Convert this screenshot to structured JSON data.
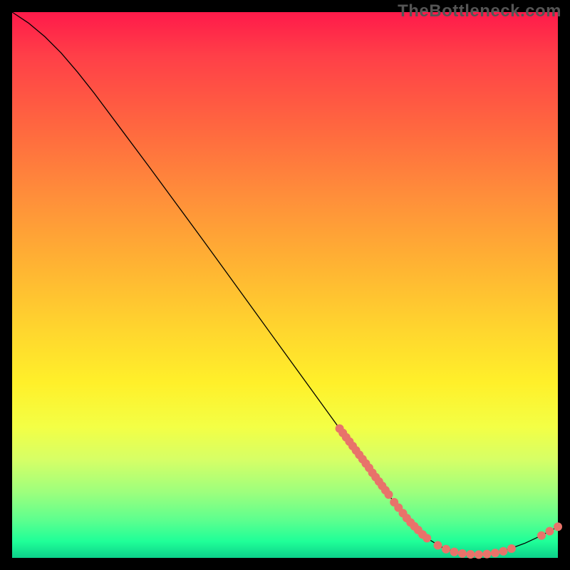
{
  "watermark": "TheBottleneck.com",
  "chart_data": {
    "type": "line",
    "title": "",
    "xlabel": "",
    "ylabel": "",
    "xlim": [
      0,
      100
    ],
    "ylim": [
      0,
      100
    ],
    "grid": false,
    "legend": false,
    "curve": [
      {
        "x": 0,
        "y": 100
      },
      {
        "x": 3,
        "y": 98
      },
      {
        "x": 6,
        "y": 95.5
      },
      {
        "x": 9,
        "y": 92.5
      },
      {
        "x": 12,
        "y": 89
      },
      {
        "x": 15,
        "y": 85.2
      },
      {
        "x": 20,
        "y": 78.5
      },
      {
        "x": 25,
        "y": 71.8
      },
      {
        "x": 30,
        "y": 65
      },
      {
        "x": 35,
        "y": 58.2
      },
      {
        "x": 40,
        "y": 51.3
      },
      {
        "x": 45,
        "y": 44.4
      },
      {
        "x": 50,
        "y": 37.5
      },
      {
        "x": 55,
        "y": 30.6
      },
      {
        "x": 60,
        "y": 23.7
      },
      {
        "x": 65,
        "y": 16.9
      },
      {
        "x": 70,
        "y": 10.2
      },
      {
        "x": 73,
        "y": 6.4
      },
      {
        "x": 76,
        "y": 3.6
      },
      {
        "x": 79,
        "y": 1.8
      },
      {
        "x": 82,
        "y": 0.9
      },
      {
        "x": 85,
        "y": 0.6
      },
      {
        "x": 88,
        "y": 0.9
      },
      {
        "x": 91,
        "y": 1.6
      },
      {
        "x": 94,
        "y": 2.7
      },
      {
        "x": 97,
        "y": 4.1
      },
      {
        "x": 100,
        "y": 5.7
      }
    ],
    "points": [
      {
        "x": 60.0,
        "y": 23.7
      },
      {
        "x": 60.6,
        "y": 22.9
      },
      {
        "x": 61.2,
        "y": 22.1
      },
      {
        "x": 61.8,
        "y": 21.3
      },
      {
        "x": 62.4,
        "y": 20.5
      },
      {
        "x": 63.0,
        "y": 19.7
      },
      {
        "x": 63.6,
        "y": 18.9
      },
      {
        "x": 64.2,
        "y": 18.1
      },
      {
        "x": 64.8,
        "y": 17.3
      },
      {
        "x": 65.4,
        "y": 16.5
      },
      {
        "x": 66.0,
        "y": 15.6
      },
      {
        "x": 66.6,
        "y": 14.8
      },
      {
        "x": 67.2,
        "y": 14.0
      },
      {
        "x": 67.8,
        "y": 13.2
      },
      {
        "x": 68.4,
        "y": 12.4
      },
      {
        "x": 69.0,
        "y": 11.6
      },
      {
        "x": 70.0,
        "y": 10.2
      },
      {
        "x": 70.8,
        "y": 9.2
      },
      {
        "x": 71.6,
        "y": 8.2
      },
      {
        "x": 72.3,
        "y": 7.3
      },
      {
        "x": 73.0,
        "y": 6.5
      },
      {
        "x": 73.7,
        "y": 5.8
      },
      {
        "x": 74.4,
        "y": 5.1
      },
      {
        "x": 75.2,
        "y": 4.3
      },
      {
        "x": 76.0,
        "y": 3.6
      },
      {
        "x": 78.0,
        "y": 2.3
      },
      {
        "x": 79.5,
        "y": 1.6
      },
      {
        "x": 81.0,
        "y": 1.1
      },
      {
        "x": 82.5,
        "y": 0.8
      },
      {
        "x": 84.0,
        "y": 0.65
      },
      {
        "x": 85.5,
        "y": 0.6
      },
      {
        "x": 87.0,
        "y": 0.7
      },
      {
        "x": 88.5,
        "y": 0.9
      },
      {
        "x": 90.0,
        "y": 1.2
      },
      {
        "x": 91.5,
        "y": 1.7
      },
      {
        "x": 97.0,
        "y": 4.1
      },
      {
        "x": 98.5,
        "y": 4.9
      },
      {
        "x": 100.0,
        "y": 5.7
      }
    ],
    "colors": {
      "point_fill": "#e8736a",
      "line_stroke": "#000000",
      "gradient_top": "#ff1a4a",
      "gradient_bottom": "#0cd08a"
    }
  }
}
